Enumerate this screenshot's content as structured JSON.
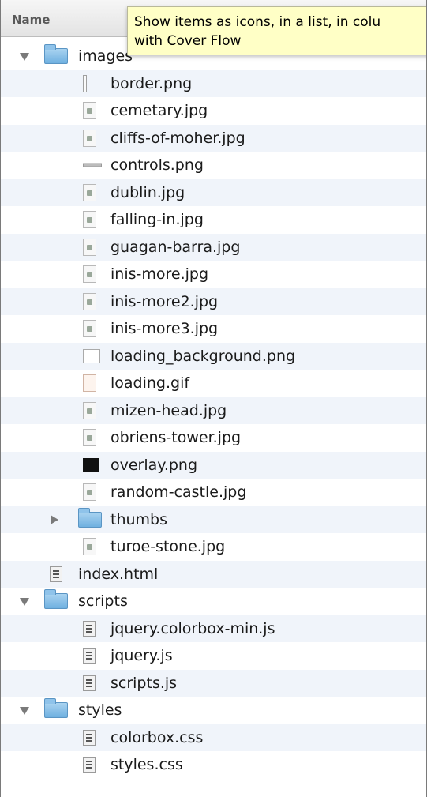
{
  "header": {
    "name_column": "Name"
  },
  "tooltip": {
    "text": "Show items as icons, in a list, in colu\nwith Cover Flow"
  },
  "rows": [
    {
      "label": "images",
      "icon": "folder-icon",
      "level": 0,
      "disclosure": "open"
    },
    {
      "label": "border.png",
      "icon": "thin-image-icon",
      "level": 1
    },
    {
      "label": "cemetary.jpg",
      "icon": "image-file-icon",
      "level": 1
    },
    {
      "label": "cliffs-of-moher.jpg",
      "icon": "image-file-icon",
      "level": 1
    },
    {
      "label": "controls.png",
      "icon": "controls-image-icon",
      "level": 1
    },
    {
      "label": "dublin.jpg",
      "icon": "image-file-icon",
      "level": 1
    },
    {
      "label": "falling-in.jpg",
      "icon": "image-file-icon",
      "level": 1
    },
    {
      "label": "guagan-barra.jpg",
      "icon": "image-file-icon",
      "level": 1
    },
    {
      "label": "inis-more.jpg",
      "icon": "image-file-icon",
      "level": 1
    },
    {
      "label": "inis-more2.jpg",
      "icon": "image-file-icon",
      "level": 1
    },
    {
      "label": "inis-more3.jpg",
      "icon": "image-file-icon",
      "level": 1
    },
    {
      "label": "loading_background.png",
      "icon": "blank-image-icon",
      "level": 1
    },
    {
      "label": "loading.gif",
      "icon": "gif-file-icon",
      "level": 1
    },
    {
      "label": "mizen-head.jpg",
      "icon": "image-file-icon",
      "level": 1
    },
    {
      "label": "obriens-tower.jpg",
      "icon": "image-file-icon",
      "level": 1
    },
    {
      "label": "overlay.png",
      "icon": "black-image-icon",
      "level": 1
    },
    {
      "label": "random-castle.jpg",
      "icon": "image-file-icon",
      "level": 1
    },
    {
      "label": "thumbs",
      "icon": "folder-icon",
      "level": 1,
      "disclosure": "closed"
    },
    {
      "label": "turoe-stone.jpg",
      "icon": "image-file-icon",
      "level": 1
    },
    {
      "label": "index.html",
      "icon": "document-icon",
      "level": 0
    },
    {
      "label": "scripts",
      "icon": "folder-icon",
      "level": 0,
      "disclosure": "open"
    },
    {
      "label": "jquery.colorbox-min.js",
      "icon": "document-icon",
      "level": 1
    },
    {
      "label": "jquery.js",
      "icon": "document-icon",
      "level": 1
    },
    {
      "label": "scripts.js",
      "icon": "document-icon",
      "level": 1
    },
    {
      "label": "styles",
      "icon": "folder-icon",
      "level": 0,
      "disclosure": "open"
    },
    {
      "label": "colorbox.css",
      "icon": "document-icon",
      "level": 1
    },
    {
      "label": "styles.css",
      "icon": "document-icon",
      "level": 1
    }
  ]
}
